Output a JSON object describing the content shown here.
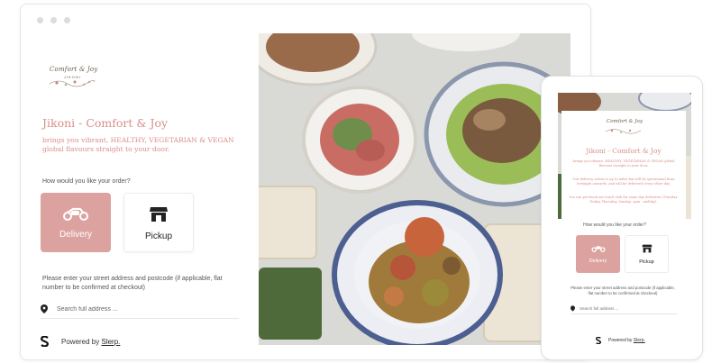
{
  "restaurant": {
    "logo_text": "Comfort & Joy",
    "logo_sub": "JIKONI",
    "title": "Jikoni - Comfort & Joy",
    "tagline": "brings you vibrant, HEALTHY, VEGETARIAN & VEGAN global flavours straight to your door."
  },
  "order": {
    "question": "How would you like your order?",
    "options": [
      {
        "label": "Delivery",
        "icon": "scooter-icon",
        "selected": true
      },
      {
        "label": "Pickup",
        "icon": "storefront-icon",
        "selected": false
      }
    ]
  },
  "address": {
    "help": "Please enter your street address and postcode (if applicable, flat number to be confirmed at checkout)",
    "placeholder": "Search full address ...",
    "icon": "location-pin-icon"
  },
  "footer": {
    "powered_prefix": "Powered by",
    "brand": "Slerp."
  },
  "mobile": {
    "title": "Jikoni - Comfort & Joy",
    "tagline": "brings you vibrant, HEALTHY, VEGETARIAN & VEGAN global flavours straight to your door.",
    "note_1": "Our delivery radius is up to miles but will be operational from fortnight onwards, and will be delivered every other day.",
    "note_2": "You can pre-book our lunch club for same day deliveries (Tuesday-Friday Thursday, Sunday: opm - midday).",
    "question": "How would you like your order?",
    "delivery_label": "Delivery",
    "pickup_label": "Pickup",
    "help": "Please enter your street address and postcode (if applicable, flat number to be confirmed at checkout)",
    "placeholder": "Search full address ...",
    "powered_prefix": "Powered by",
    "brand": "Slerp."
  },
  "colors": {
    "accent": "#dca2a0",
    "title": "#d98e8a"
  }
}
